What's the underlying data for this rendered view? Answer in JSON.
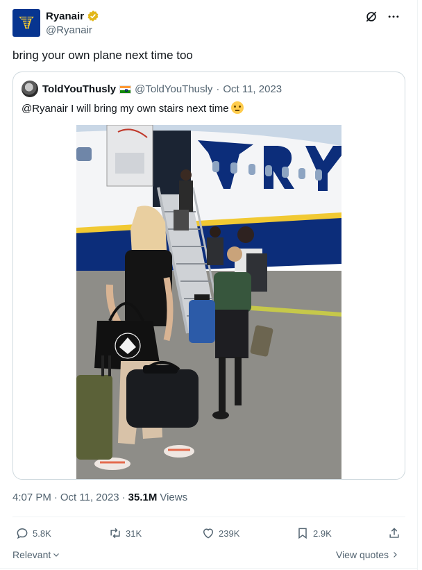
{
  "account": {
    "display_name": "Ryanair",
    "handle": "@Ryanair",
    "avatar_icon": "ryanair-harp-logo",
    "verified_icon": "gold-verified-badge"
  },
  "tweet": {
    "text": "bring your own plane next time too"
  },
  "quoted": {
    "display_name": "ToldYouThusly",
    "flag_icon": "india-flag",
    "handle": "@ToldYouThusly",
    "separator": "·",
    "date": "Oct 11, 2023",
    "text": "@Ryanair I will bring my own stairs next time",
    "emoji_icon": "face-with-rolling-eyes"
  },
  "meta": {
    "time": "4:07 PM",
    "dot1": "·",
    "date": "Oct 11, 2023",
    "dot2": "·",
    "views_count": "35.1M",
    "views_label": "Views"
  },
  "actions": {
    "replies": "5.8K",
    "reposts": "31K",
    "likes": "239K",
    "bookmarks": "2.9K"
  },
  "footer": {
    "sort_label": "Relevant",
    "view_quotes_label": "View quotes"
  },
  "colors": {
    "ryanair_blue": "#073590",
    "ryanair_yellow": "#f1c933",
    "text_secondary": "#536471",
    "border": "#cfd9de"
  }
}
